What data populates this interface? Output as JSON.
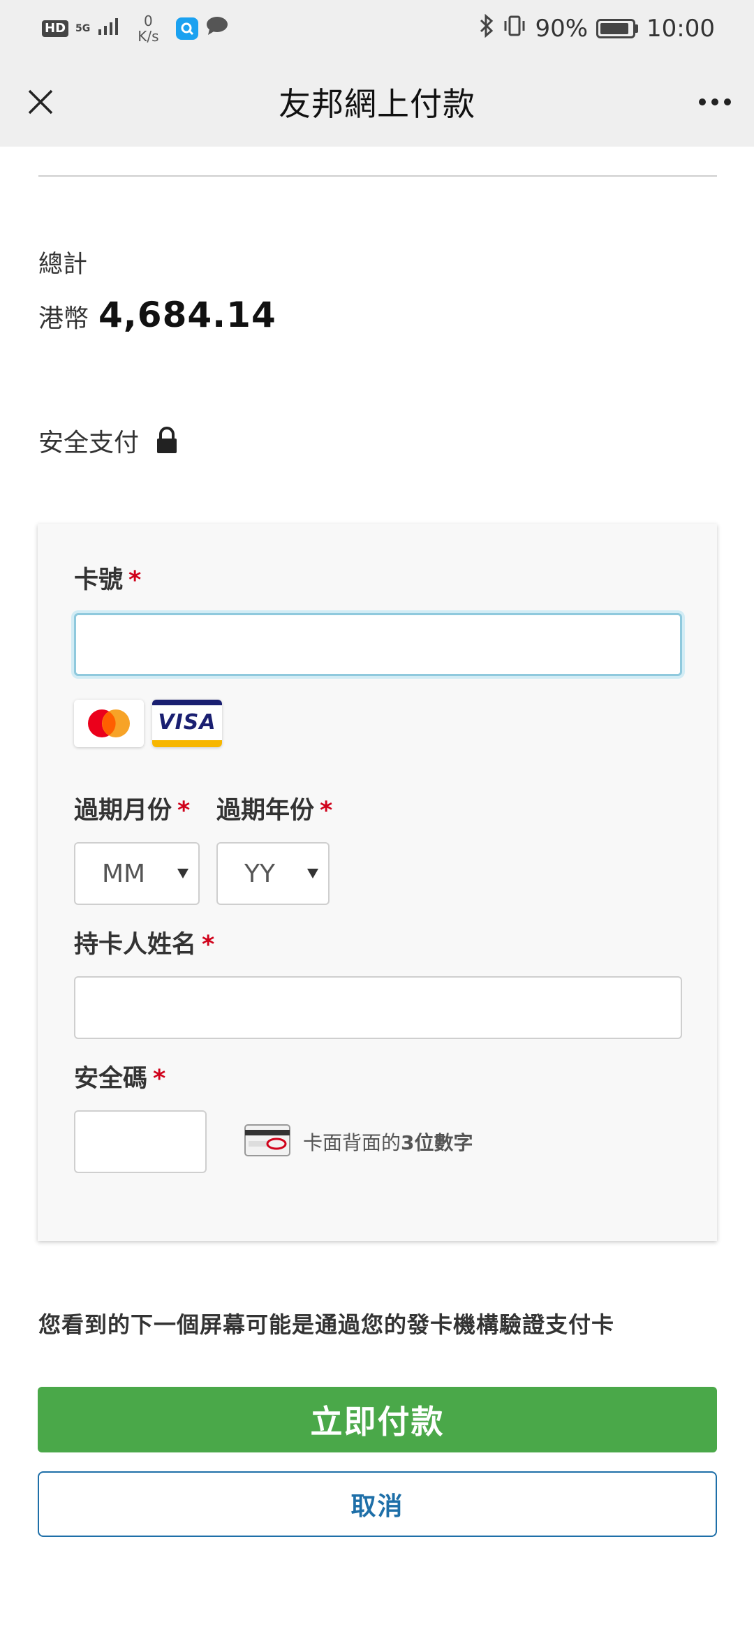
{
  "status_bar": {
    "hd": "HD",
    "network": "5G",
    "speed_value": "0",
    "speed_unit": "K/s",
    "battery": "90%",
    "time": "10:00",
    "icons": [
      "signal-icon",
      "search-app-icon",
      "chat-icon",
      "bluetooth-icon",
      "vibrate-icon",
      "battery-icon"
    ]
  },
  "header": {
    "title": "友邦網上付款",
    "close_icon": "close-icon",
    "more_icon": "more-icon"
  },
  "summary": {
    "total_label": "總計",
    "currency": "港幣",
    "amount": "4,684.14"
  },
  "secure": {
    "label": "安全支付",
    "icon": "lock-icon"
  },
  "form": {
    "card_number": {
      "label": "卡號",
      "required": "*",
      "value": ""
    },
    "card_brands": [
      "mastercard",
      "VISA"
    ],
    "expiry_month": {
      "label": "過期月份",
      "required": "*",
      "selected": "MM"
    },
    "expiry_year": {
      "label": "過期年份",
      "required": "*",
      "selected": "YY"
    },
    "holder_name": {
      "label": "持卡人姓名",
      "required": "*",
      "value": ""
    },
    "cvv": {
      "label": "安全碼",
      "required": "*",
      "value": "",
      "hint_prefix": "卡面背面的",
      "hint_bold": "3位數字"
    }
  },
  "notice": "您看到的下一個屏幕可能是通過您的發卡機構驗證支付卡",
  "buttons": {
    "pay": "立即付款",
    "cancel": "取消"
  },
  "colors": {
    "pay_button": "#4aa849",
    "cancel_border": "#1e6fa8",
    "required": "#d0021b",
    "focus_ring": "#8fc9dd"
  }
}
